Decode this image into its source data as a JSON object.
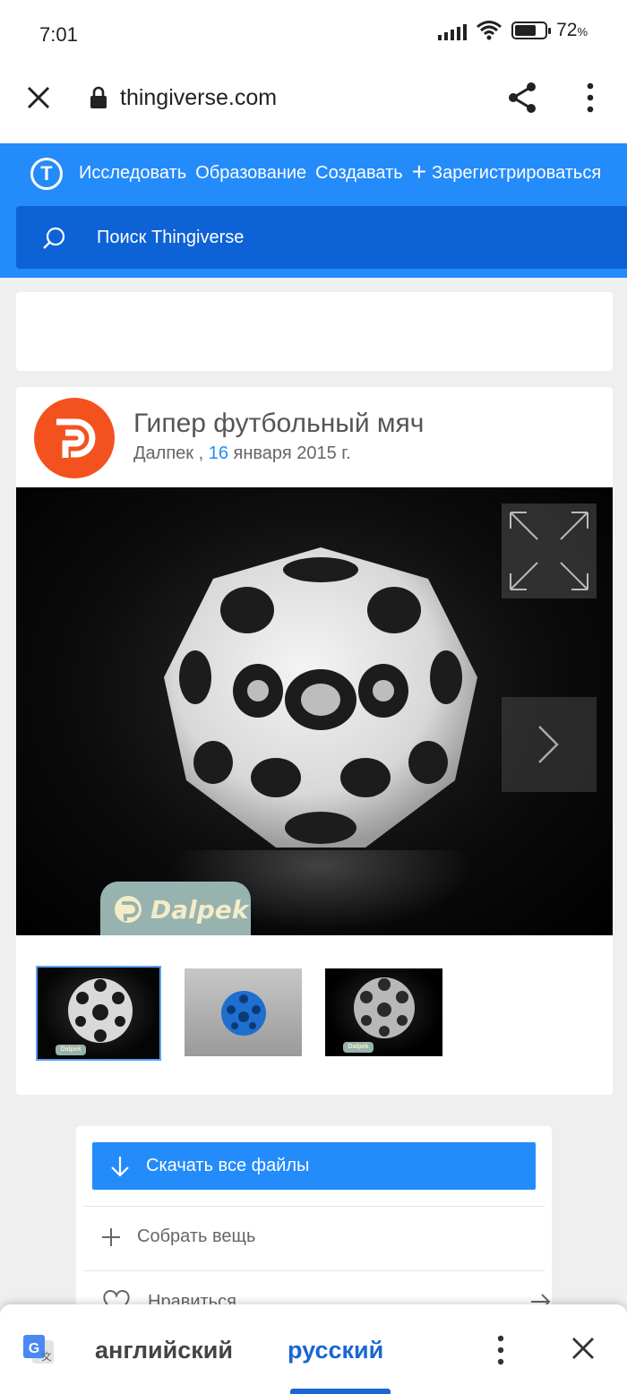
{
  "status_bar": {
    "time": "7:01",
    "battery": "72",
    "battery_unit": "%"
  },
  "browser": {
    "url": "thingiverse.com"
  },
  "site_nav": {
    "logo_letter": "T",
    "links": [
      "Исследовать",
      "Образование",
      "Создавать",
      "Зарегистрироваться"
    ],
    "search_placeholder": "Поиск Thingiverse"
  },
  "thing": {
    "title": "Гипер футбольный мяч",
    "author": "Далпек",
    "date_sep": " , ",
    "date_day": "16",
    "date_rest": " января 2015 г.",
    "watermark": "Dalpek",
    "thumb_tag": "Dalpek",
    "thumbnails": [
      "white-ball-dark",
      "blue-ball-grey",
      "silver-ball-dark"
    ]
  },
  "actions": {
    "download": "Скачать все файлы",
    "collect": "Собрать вещь",
    "like": "Нравиться"
  },
  "translate_bar": {
    "source_lang": "английский",
    "target_lang": "русский"
  },
  "colors": {
    "brand_blue": "#248bfb",
    "search_blue": "#0d63d6",
    "avatar_orange": "#f3521f",
    "translate_blue": "#1a66d2"
  }
}
